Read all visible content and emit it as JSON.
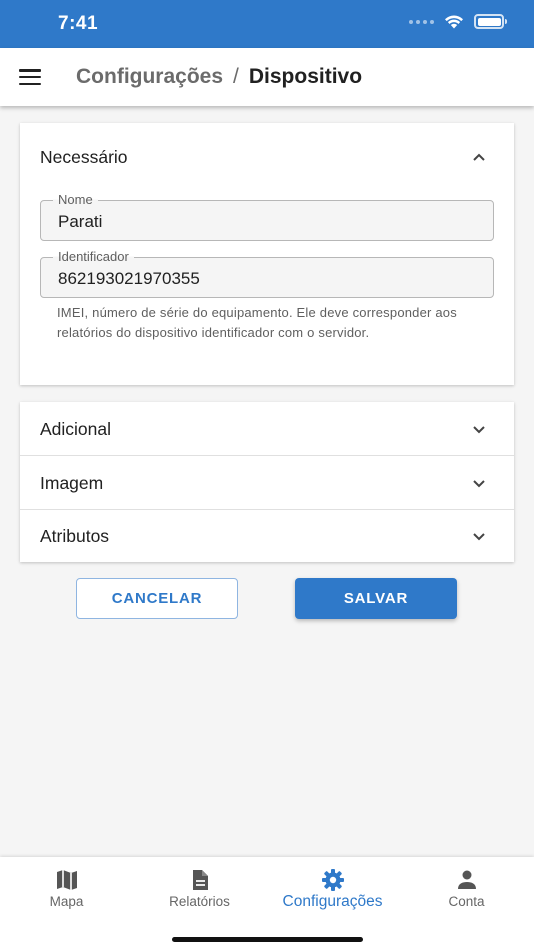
{
  "status_bar": {
    "time": "7:41"
  },
  "header": {
    "breadcrumb_parent": "Configurações",
    "breadcrumb_separator": "/",
    "breadcrumb_current": "Dispositivo"
  },
  "sections": {
    "necessary": {
      "title": "Necessário",
      "name_field": {
        "label": "Nome",
        "value": "Parati"
      },
      "identifier_field": {
        "label": "Identificador",
        "value": "862193021970355"
      },
      "identifier_helper": "IMEI, número de série do equipamento. Ele deve corresponder aos relatórios do dispositivo identificador com o servidor."
    },
    "additional": {
      "title": "Adicional"
    },
    "image": {
      "title": "Imagem"
    },
    "attributes": {
      "title": "Atributos"
    }
  },
  "actions": {
    "cancel_label": "CANCELAR",
    "save_label": "SALVAR"
  },
  "bottom_nav": {
    "items": [
      {
        "label": "Mapa",
        "icon": "map-icon"
      },
      {
        "label": "Relatórios",
        "icon": "document-icon"
      },
      {
        "label": "Configurações",
        "icon": "gear-icon"
      },
      {
        "label": "Conta",
        "icon": "person-icon"
      }
    ],
    "active_index": 2
  },
  "colors": {
    "primary": "#2f79c9",
    "background": "#f5f5f5",
    "text": "#212121",
    "muted": "#5f5f5f"
  }
}
